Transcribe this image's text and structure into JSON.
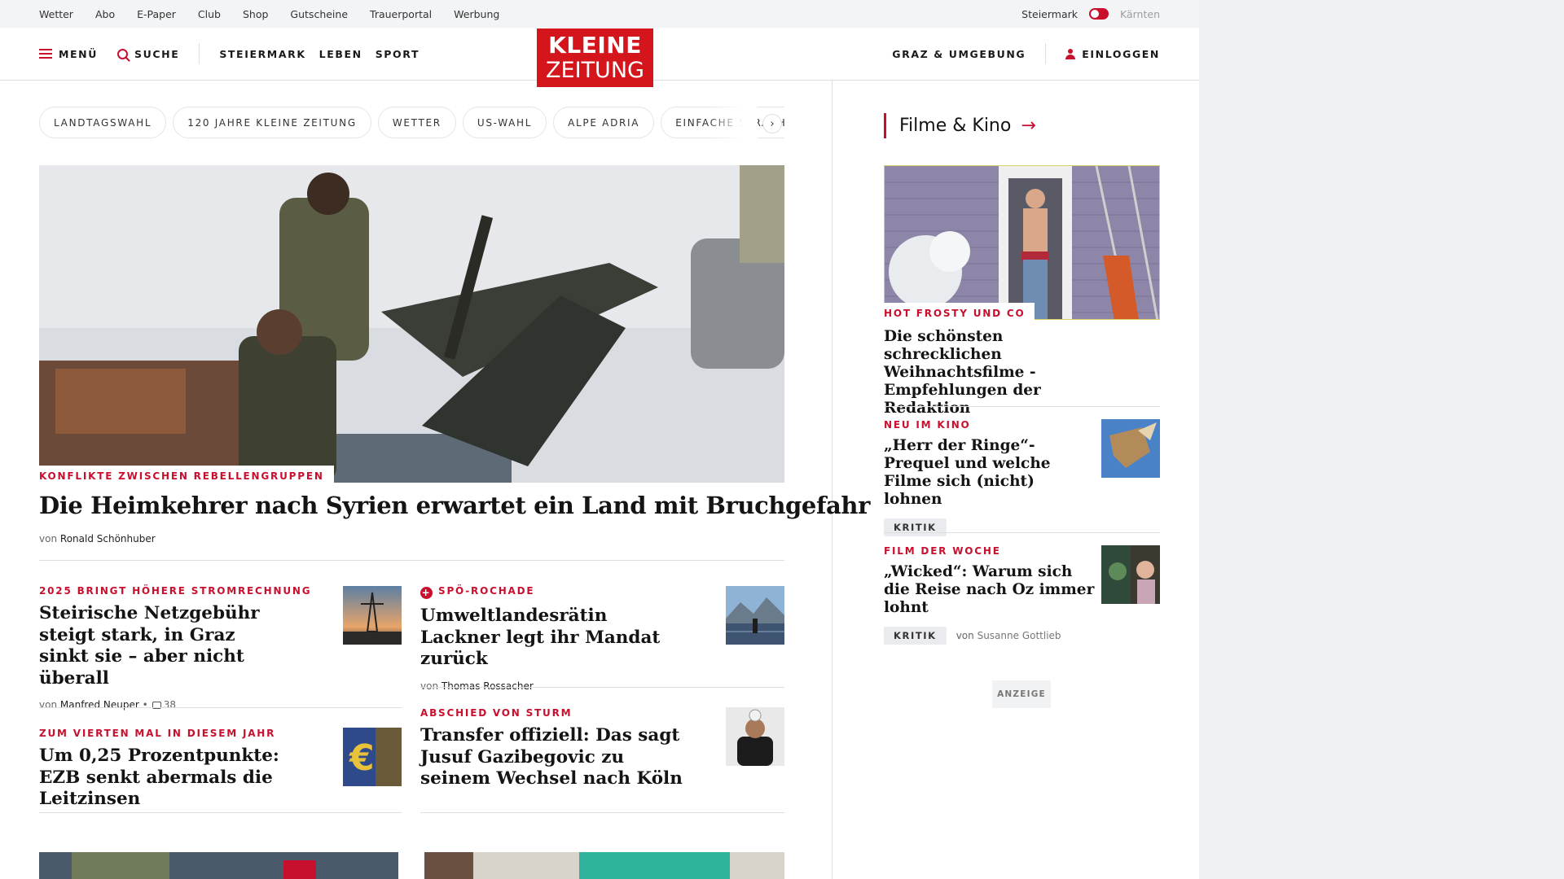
{
  "utility_bar": {
    "links": [
      "Wetter",
      "Abo",
      "E-Paper",
      "Club",
      "Shop",
      "Gutscheine",
      "Trauerportal",
      "Werbung"
    ],
    "region_active": "Steiermark",
    "region_inactive": "Kärnten"
  },
  "header": {
    "menu_label": "MENÜ",
    "search_label": "SUCHE",
    "nav": [
      "STEIERMARK",
      "LEBEN",
      "SPORT"
    ],
    "logo_line1": "KLEINE",
    "logo_line2": "ZEITUNG",
    "region_link": "GRAZ & UMGEBUNG",
    "login_label": "EINLOGGEN",
    "brand_color": "#d4151c"
  },
  "topic_chips": [
    "LANDTAGSWAHL",
    "120 JAHRE KLEINE ZEITUNG",
    "WETTER",
    "US-WAHL",
    "ALPE ADRIA",
    "EINFACHE SPRACHE"
  ],
  "hero": {
    "kicker": "KONFLIKTE ZWISCHEN REBELLENGRUPPEN",
    "title": "Die Heimkehrer nach Syrien erwartet ein Land mit Bruchgefahr",
    "by_prefix": "von",
    "author": "Ronald Schönhuber"
  },
  "teasers": [
    {
      "kicker": "2025 BRINGT HÖHERE STROMRECHNUNG",
      "title": "Steirische Netzgebühr steigt stark, in Graz sinkt sie – aber nicht überall",
      "by_prefix": "von",
      "author": "Manfred Neuper",
      "separator": "•",
      "comments": "38",
      "thumb_icon": "power-pylon-sunset"
    },
    {
      "kicker": "SPÖ-ROCHADE",
      "plus_badge": "+",
      "title": "Umweltlandesrätin Lackner legt ihr Mandat zurück",
      "by_prefix": "von",
      "author": "Thomas Rossacher",
      "thumb_icon": "mountain-solar-field"
    },
    {
      "kicker": "ZUM VIERTEN MAL IN DIESEM JAHR",
      "title": "Um 0,25 Prozentpunkte: EZB senkt abermals die Leitzinsen",
      "thumb_icon": "euro-sculpture"
    },
    {
      "kicker": "ABSCHIED VON STURM",
      "title": "Transfer offiziell: Das sagt Jusuf Gazibegovic zu seinem Wechsel nach Köln",
      "thumb_icon": "football-player"
    }
  ],
  "sidebar": {
    "section_title": "Filme & Kino",
    "section_arrow": "→",
    "lead": {
      "kicker": "HOT FROSTY UND CO",
      "title": "Die schönsten schrecklichen Weihnachtsfilme - Empfehlungen der Redaktion"
    },
    "items": [
      {
        "kicker": "NEU IM KINO",
        "title": "„Herr der Ringe“-Prequel und welche Filme sich (nicht) lohnen",
        "badge": "KRITIK",
        "thumb_icon": "eagle-sky"
      },
      {
        "kicker": "FILM DER WOCHE",
        "title": "„Wicked“: Warum sich die Reise nach Oz immer lohnt",
        "badge": "KRITIK",
        "by_prefix": "von",
        "author": "Susanne Gottlieb",
        "thumb_icon": "wicked-characters"
      }
    ],
    "ad_label": "ANZEIGE"
  },
  "colors": {
    "accent": "#c8102e",
    "text": "#141414",
    "divider": "#dcdfe3",
    "utility_bg": "#f3f4f6",
    "page_bg": "#eef0f3"
  }
}
